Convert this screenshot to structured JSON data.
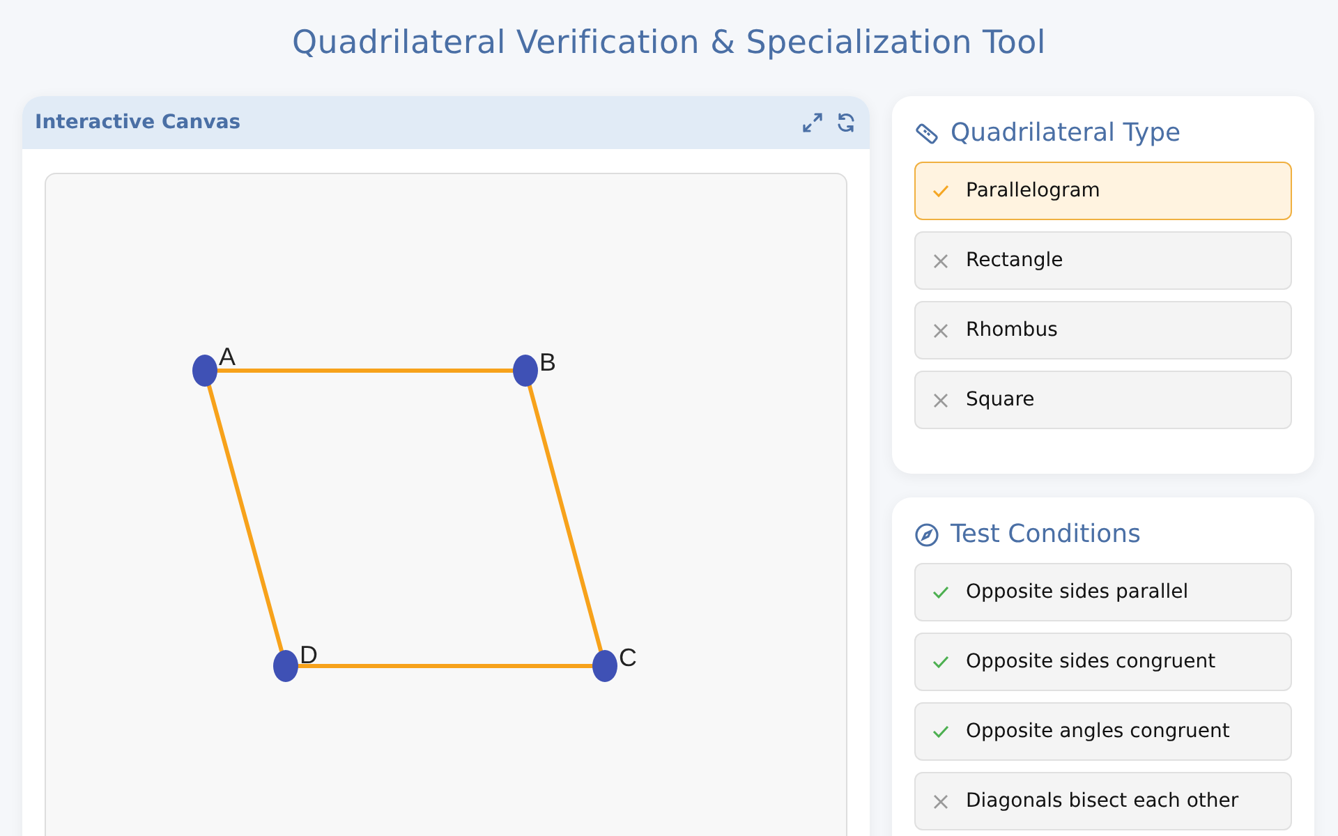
{
  "title": "Quadrilateral Verification & Specialization Tool",
  "canvas_panel": {
    "title": "Interactive Canvas",
    "vertices": [
      {
        "label": "A"
      },
      {
        "label": "B"
      },
      {
        "label": "C"
      },
      {
        "label": "D"
      }
    ]
  },
  "type_panel": {
    "title": "Quadrilateral Type",
    "items": [
      {
        "label": "Parallelogram",
        "checked": true
      },
      {
        "label": "Rectangle",
        "checked": false
      },
      {
        "label": "Rhombus",
        "checked": false
      },
      {
        "label": "Square",
        "checked": false
      }
    ]
  },
  "conditions_panel": {
    "title": "Test Conditions",
    "items": [
      {
        "label": "Opposite sides parallel",
        "checked": true
      },
      {
        "label": "Opposite sides congruent",
        "checked": true
      },
      {
        "label": "Opposite angles congruent",
        "checked": true
      },
      {
        "label": "Diagonals bisect each other",
        "checked": false
      }
    ]
  }
}
